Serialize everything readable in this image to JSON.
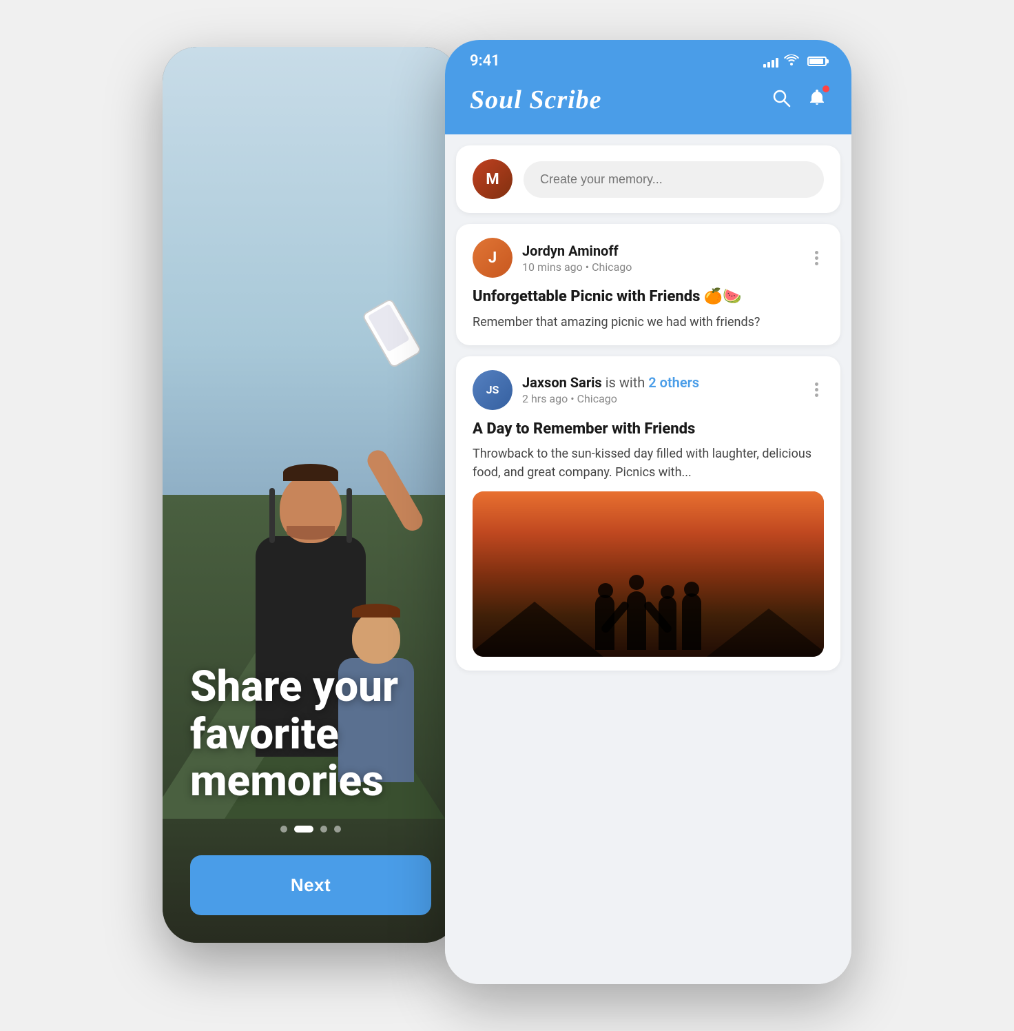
{
  "leftPhone": {
    "heroText": "Share your favorite memories",
    "dots": [
      {
        "active": false
      },
      {
        "active": true
      },
      {
        "active": false
      },
      {
        "active": false
      }
    ],
    "nextButton": {
      "label": "Next"
    }
  },
  "rightPhone": {
    "statusBar": {
      "time": "9:41",
      "signalBars": 4,
      "batteryPercent": 85
    },
    "header": {
      "title": "Soul Scribe",
      "searchLabel": "search",
      "notificationLabel": "notifications"
    },
    "createMemory": {
      "placeholder": "Create your memory...",
      "avatarInitial": "M"
    },
    "posts": [
      {
        "id": "post1",
        "author": "Jordyn Aminoff",
        "withText": "",
        "withOthers": "",
        "timeAgo": "10 mins ago",
        "location": "Chicago",
        "title": "Unforgettable Picnic with Friends 🍊🍉",
        "body": "Remember that amazing picnic we had with friends?",
        "avatarInitial": "J",
        "hasImage": false
      },
      {
        "id": "post2",
        "author": "Jaxson Saris",
        "withText": " is with ",
        "withOthers": "2 others",
        "timeAgo": "2 hrs ago",
        "location": "Chicago",
        "title": "A Day to Remember with Friends",
        "body": "Throwback to the sun-kissed day filled with laughter, delicious food, and great company. Picnics with...",
        "avatarInitial": "JS",
        "hasImage": true
      }
    ]
  }
}
